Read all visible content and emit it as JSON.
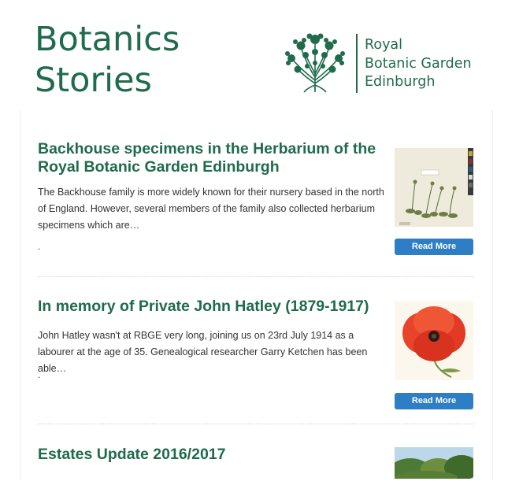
{
  "header": {
    "title_line1": "Botanics",
    "title_line2": "Stories",
    "logo": {
      "line1": "Royal",
      "line2": "Botanic Garden",
      "line3": "Edinburgh"
    }
  },
  "articles": [
    {
      "title": "Backhouse specimens in the Herbarium of the Royal Botanic Garden Edinburgh",
      "excerpt": "The Backhouse family is more widely known for their nursery based in the north of England. However, several members of the family also collected herbarium specimens which are…",
      "dot": ".",
      "read_more": "Read More"
    },
    {
      "title": "In memory of Private John Hatley (1879-1917)",
      "excerpt": "John Hatley wasn't at RBGE very long, joining us on 23rd July 1914 as a labourer at the age of 35. Genealogical researcher Garry Ketchen has been able…",
      "dot": ".",
      "read_more": "Read More"
    },
    {
      "title": "Estates Update 2016/2017"
    }
  ],
  "colors": {
    "brand_green": "#1f6b4c",
    "button_blue": "#2d7ec4"
  }
}
